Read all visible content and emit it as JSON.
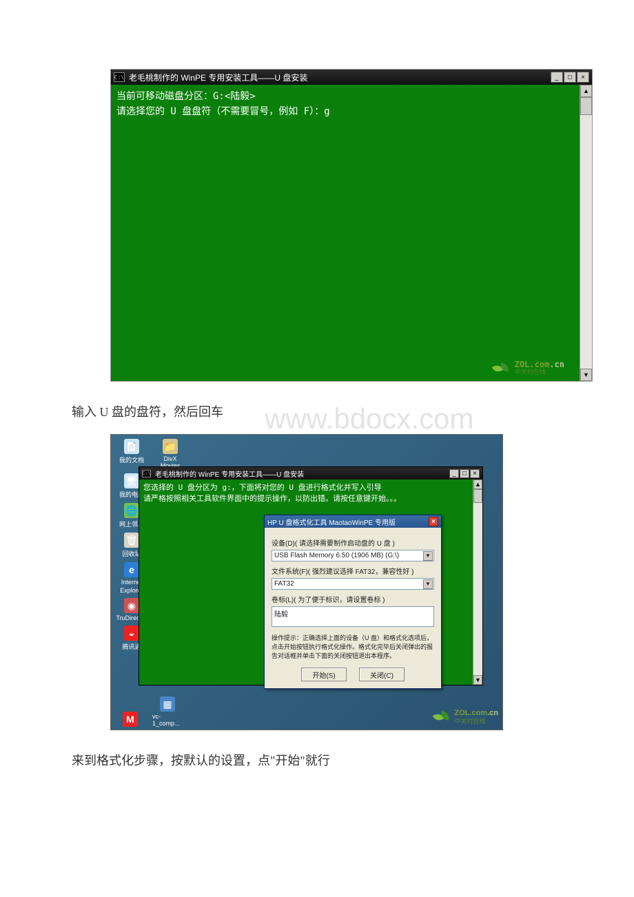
{
  "screenshot1": {
    "title_prefix": "C:\\",
    "title": "老毛桃制作的 WinPE 专用安装工具——U 盘安装",
    "line1": "当前可移动磁盘分区：G:<陆毅>",
    "line2": "请选择您的 U 盘盘符（不需要冒号，例如 F）：g",
    "watermark": {
      "brand": "ZOL.com",
      "suffix": ".cn",
      "sub": "中关村在线"
    }
  },
  "caption1": "输入 U 盘的盘符，然后回车",
  "page_watermark": "www.bdocx.com",
  "desktop_icons": {
    "docs": "我的文档",
    "divx": "DivX Movies",
    "comp": "我的电脑",
    "net": "网上邻居",
    "bin": "回收站",
    "ie1": "Internet",
    "ie2": "Explorer",
    "dvd": "TruDirect V",
    "qq": "腾讯通",
    "vc": "vc-1_comp..."
  },
  "screenshot2": {
    "title": "老毛桃制作的 WinPE 专用安装工具——U 盘安装",
    "line1": "您选择的 U 盘分区为 g:，下面将对您的 U 盘进行格式化并写入引导",
    "line2": "请严格按照相关工具软件界面中的提示操作，以防出错。请按任意键开始。。。"
  },
  "dialog": {
    "title": "HP U 盘格式化工具 MaotaoWinPE 专用版",
    "device_label": "设备(D)( 请选择需要制作启动盘的 U 盘 )",
    "device_value": "USB Flash Memory 6.50 (1906 MB) (G:\\)",
    "fs_label": "文件系统(F)( 强烈建议选择 FAT32，兼容性好 )",
    "fs_value": "FAT32",
    "vol_label": "卷标(L)( 为了便于标识，请设置卷标 )",
    "vol_value": "陆毅",
    "hint": "操作提示：正确选择上面的设备（U 盘）和格式化选项后，点击开始按钮执行格式化操作。格式化完毕后关闭弹出的报告对话框并单击下面的关闭按钮退出本程序。",
    "btn_start": "开始(S)",
    "btn_close": "关闭(C)"
  },
  "caption2": "来到格式化步骤，按默认的设置，点\"开始\"就行",
  "glyphs": {
    "min": "_",
    "max": "□",
    "close": "×",
    "up": "▲",
    "down": "▼",
    "dd": "▼",
    "ie": "e",
    "m": "M"
  }
}
